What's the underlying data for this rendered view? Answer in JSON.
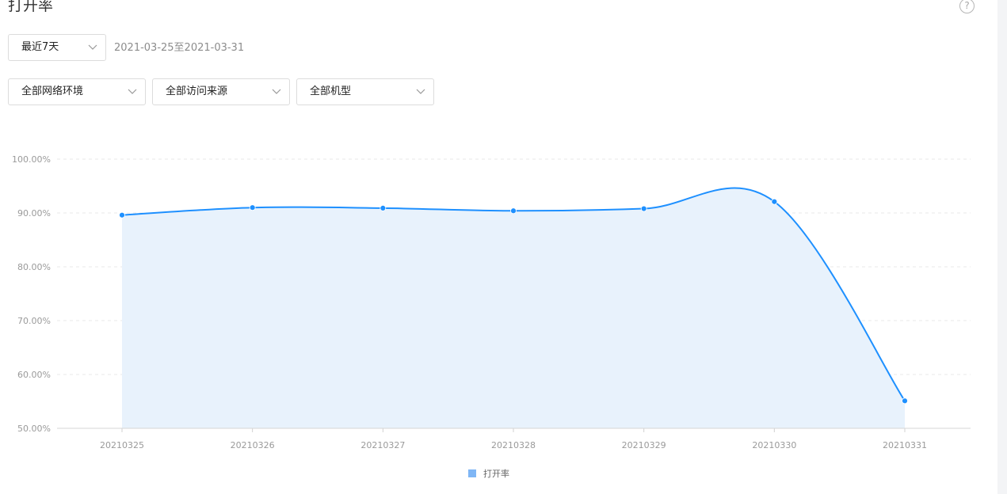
{
  "header": {
    "title": "打开率",
    "help_symbol": "?"
  },
  "filters": {
    "range_select": "最近7天",
    "date_range": "2021-03-25至2021-03-31",
    "network_select": "全部网络环境",
    "source_select": "全部访问来源",
    "model_select": "全部机型"
  },
  "colors": {
    "line": "#1e90ff",
    "area": "#e8f2fc",
    "legend_swatch": "#7fb6f5"
  },
  "chart_data": {
    "type": "area",
    "x": [
      "20210325",
      "20210326",
      "20210327",
      "20210328",
      "20210329",
      "20210330",
      "20210331"
    ],
    "series": [
      {
        "name": "打开率",
        "values": [
          89.6,
          91.0,
          90.9,
          90.4,
          90.8,
          92.1,
          55.1
        ]
      }
    ],
    "y_ticks": [
      "100.00%",
      "90.00%",
      "80.00%",
      "70.00%",
      "60.00%",
      "50.00%"
    ],
    "ylim": [
      50,
      100
    ],
    "smooth": true,
    "grid": "horizontal-dashed",
    "legend": "bottom-center"
  }
}
